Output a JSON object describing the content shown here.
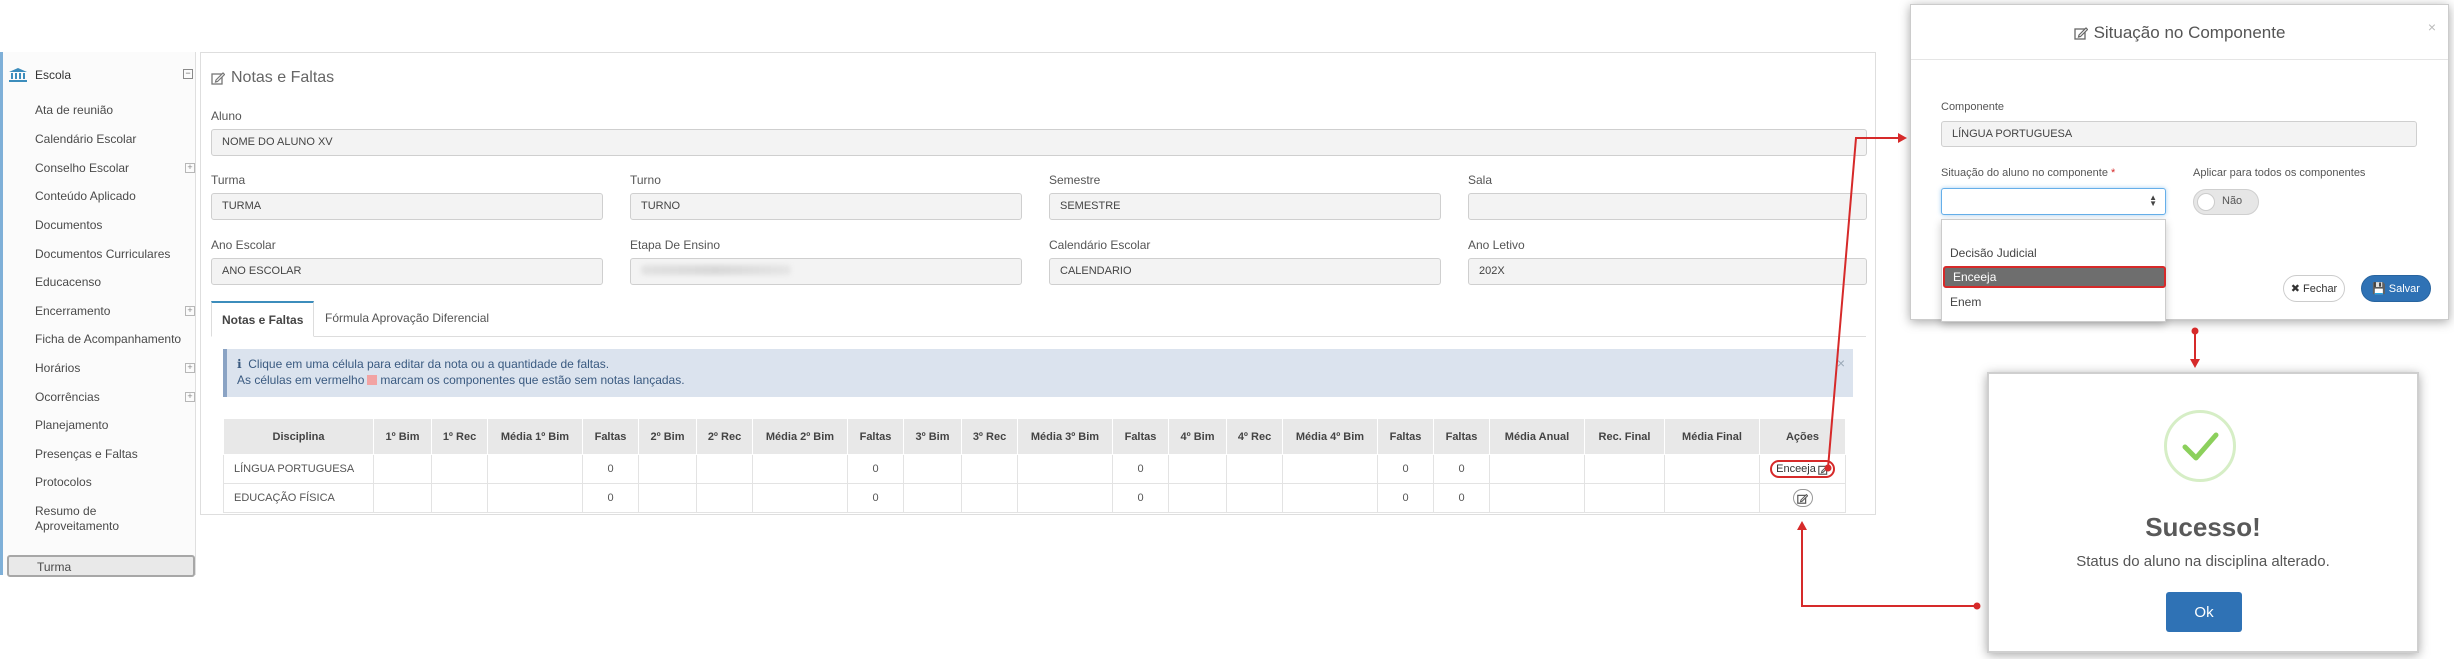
{
  "sidebar": {
    "header": "Escola",
    "items": [
      {
        "label": "Ata de reunião",
        "expandable": false
      },
      {
        "label": "Calendário Escolar",
        "expandable": false
      },
      {
        "label": "Conselho Escolar",
        "expandable": true
      },
      {
        "label": "Conteúdo Aplicado",
        "expandable": false
      },
      {
        "label": "Documentos",
        "expandable": false
      },
      {
        "label": "Documentos Curriculares",
        "expandable": false
      },
      {
        "label": "Educacenso",
        "expandable": false
      },
      {
        "label": "Encerramento",
        "expandable": true
      },
      {
        "label": "Ficha de Acompanhamento",
        "expandable": false
      },
      {
        "label": "Horários",
        "expandable": true
      },
      {
        "label": "Ocorrências",
        "expandable": true
      },
      {
        "label": "Planejamento",
        "expandable": false
      },
      {
        "label": "Presenças e Faltas",
        "expandable": false
      },
      {
        "label": "Protocolos",
        "expandable": false
      },
      {
        "label": "Resumo de",
        "label2": "Aproveitamento",
        "expandable": false
      },
      {
        "label": "Turma",
        "expandable": false,
        "active": true
      }
    ]
  },
  "main": {
    "title": "Notas e Faltas",
    "aluno_label": "Aluno",
    "aluno_value": "NOME DO ALUNO XV",
    "fields": {
      "turma_label": "Turma",
      "turma_value": "TURMA",
      "turno_label": "Turno",
      "turno_value": "TURNO",
      "semestre_label": "Semestre",
      "semestre_value": "SEMESTRE",
      "sala_label": "Sala",
      "sala_value": "",
      "ano_escolar_label": "Ano Escolar",
      "ano_escolar_value": "ANO ESCOLAR",
      "etapa_label": "Etapa De Ensino",
      "calendario_label": "Calendário Escolar",
      "calendario_value": "CALENDARIO",
      "ano_letivo_label": "Ano Letivo",
      "ano_letivo_value": "202X"
    },
    "tabs": [
      "Notas e Faltas",
      "Fórmula Aprovação Diferencial"
    ],
    "alert_line1": "Clique em uma célula para editar da nota ou a quantidade de faltas.",
    "alert_line2a": "As células em vermelho",
    "alert_line2b": "marcam os componentes que estão sem notas lançadas.",
    "table": {
      "headers": [
        "Disciplina",
        "1º Bim",
        "1º Rec",
        "Média 1º Bim",
        "Faltas",
        "2º Bim",
        "2º Rec",
        "Média 2º Bim",
        "Faltas",
        "3º Bim",
        "3º Rec",
        "Média 3º Bim",
        "Faltas",
        "4º Bim",
        "4º Rec",
        "Média 4º Bim",
        "Faltas",
        "Faltas",
        "Média Anual",
        "Rec. Final",
        "Média Final",
        "Ações"
      ],
      "rows": [
        {
          "cells": [
            "LÍNGUA PORTUGUESA",
            "",
            "",
            "",
            "0",
            "",
            "",
            "",
            "0",
            "",
            "",
            "",
            "0",
            "",
            "",
            "",
            "0",
            "0",
            "",
            "",
            ""
          ],
          "action": "Enceeja"
        },
        {
          "cells": [
            "EDUCAÇÃO FÍSICA",
            "",
            "",
            "",
            "0",
            "",
            "",
            "",
            "0",
            "",
            "",
            "",
            "0",
            "",
            "",
            "",
            "0",
            "0",
            "",
            "",
            ""
          ],
          "action": ""
        }
      ]
    }
  },
  "modal_situacao": {
    "title": "Situação no Componente",
    "componente_label": "Componente",
    "componente_value": "LÍNGUA PORTUGUESA",
    "situacao_label": "Situação do aluno no componente",
    "required_mark": "*",
    "aplicar_label": "Aplicar para todos os componentes",
    "switch_value": "Não",
    "options": [
      "Decisão Judicial",
      "Enceeja",
      "Enem"
    ],
    "selected_option": "Enceeja",
    "close_symbol": "×",
    "fechar_label": "Fechar",
    "salvar_label": "Salvar"
  },
  "modal_sucesso": {
    "title": "Sucesso!",
    "message": "Status do aluno na disciplina alterado.",
    "ok_label": "Ok"
  },
  "colors": {
    "primary": "#2f72b5",
    "highlight": "#d62a2a",
    "success": "#8cd05c"
  }
}
